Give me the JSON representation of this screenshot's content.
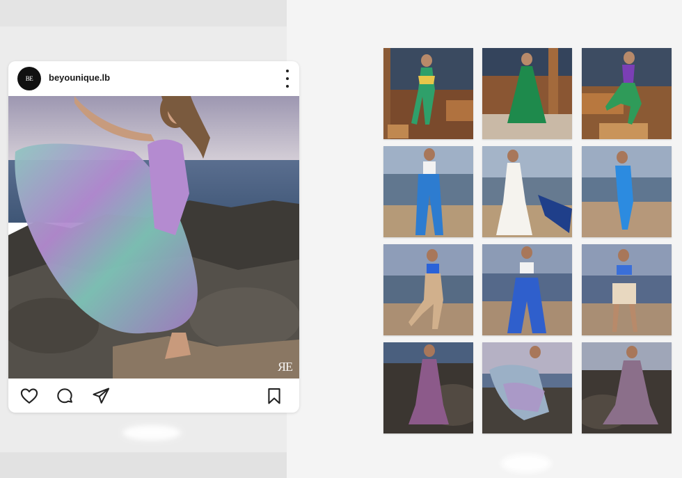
{
  "post": {
    "username": "beyounique.lb",
    "avatar_text": "BE",
    "avatar_icon": "brand-logo",
    "watermark": "ЯE",
    "more_icon": "more-vertical-icon",
    "actions": [
      {
        "icon": "heart-icon",
        "label": "Like"
      },
      {
        "icon": "comment-icon",
        "label": "Comment"
      },
      {
        "icon": "share-icon",
        "label": "Share"
      },
      {
        "icon": "bookmark-icon",
        "label": "Save"
      }
    ]
  },
  "grid": {
    "rows": 4,
    "columns": 3,
    "tiles": [
      {
        "scene": "wooden-gazebo",
        "outfit": "green-patterned-jumpsuit"
      },
      {
        "scene": "wooden-gazebo",
        "outfit": "green-dress"
      },
      {
        "scene": "wooden-gazebo",
        "outfit": "purple-top-green-pants"
      },
      {
        "scene": "beach",
        "outfit": "white-top-blue-pants"
      },
      {
        "scene": "beach",
        "outfit": "white-dress-blue-scarf"
      },
      {
        "scene": "beach",
        "outfit": "blue-jumpsuit"
      },
      {
        "scene": "beach",
        "outfit": "blue-top-beige-pants"
      },
      {
        "scene": "beach",
        "outfit": "white-top-blue-wide-pants"
      },
      {
        "scene": "beach",
        "outfit": "blue-top-beige-shorts"
      },
      {
        "scene": "rocky-shore",
        "outfit": "purple-printed-dress"
      },
      {
        "scene": "rocky-shore",
        "outfit": "flowing-patterned-dress"
      },
      {
        "scene": "rocky-shore",
        "outfit": "mauve-printed-dress"
      }
    ]
  },
  "colors": {
    "page_bg": "#ececec",
    "card_bg": "#ffffff",
    "icon": "#222222"
  }
}
